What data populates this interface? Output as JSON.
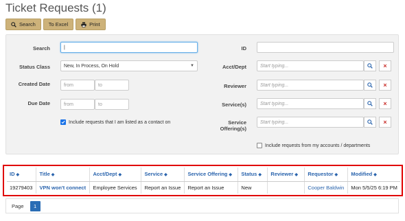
{
  "page": {
    "title": "Ticket Requests (1)"
  },
  "toolbar": {
    "search_label": "Search",
    "excel_label": "To Excel",
    "print_label": "Print"
  },
  "filters": {
    "search_label": "Search",
    "search_value": "|",
    "id_label": "ID",
    "id_value": "",
    "status_label": "Status Class",
    "status_value": "New, In Process, On Hold",
    "acct_label": "Acct/Dept",
    "acct_placeholder": "Start typing...",
    "created_label": "Created Date",
    "created_from_placeholder": "from",
    "created_to_placeholder": "to",
    "reviewer_label": "Reviewer",
    "reviewer_placeholder": "Start typing...",
    "due_label": "Due Date",
    "due_from_placeholder": "from",
    "due_to_placeholder": "to",
    "services_label": "Service(s)",
    "services_placeholder": "Start typing...",
    "offerings_label_line1": "Service",
    "offerings_label_line2": "Offering(s)",
    "offerings_placeholder": "Start typing...",
    "contact_checkbox_label": "Include requests that I am listed as a contact on",
    "contact_checked": true,
    "accounts_checkbox_label": "Include requests from my accounts / departments",
    "accounts_checked": false
  },
  "results": {
    "columns": [
      "ID",
      "Title",
      "Acct/Dept",
      "Service",
      "Service Offering",
      "Status",
      "Reviewer",
      "Requestor",
      "Modified"
    ],
    "rows": [
      {
        "id": "19279403",
        "title": "VPN won't connect",
        "acct": "Employee Services",
        "service": "Report an Issue",
        "offering": "Report an Issue",
        "status": "New",
        "reviewer": "",
        "requestor": "Cooper Baldwin",
        "modified": "Mon 5/5/25 6:19 PM"
      }
    ]
  },
  "pager": {
    "label": "Page",
    "current": "1"
  },
  "colors": {
    "accent_button": "#cdb27a",
    "link": "#2a64ad",
    "highlight_border": "#e00000",
    "page_active": "#2a6db5",
    "clear_red": "#c9302c"
  },
  "icons": {
    "search": "search-icon",
    "print": "print-icon",
    "sort": "sort-icon",
    "clear": "close-icon",
    "caret": "chevron-down-icon",
    "check": "check-icon"
  }
}
